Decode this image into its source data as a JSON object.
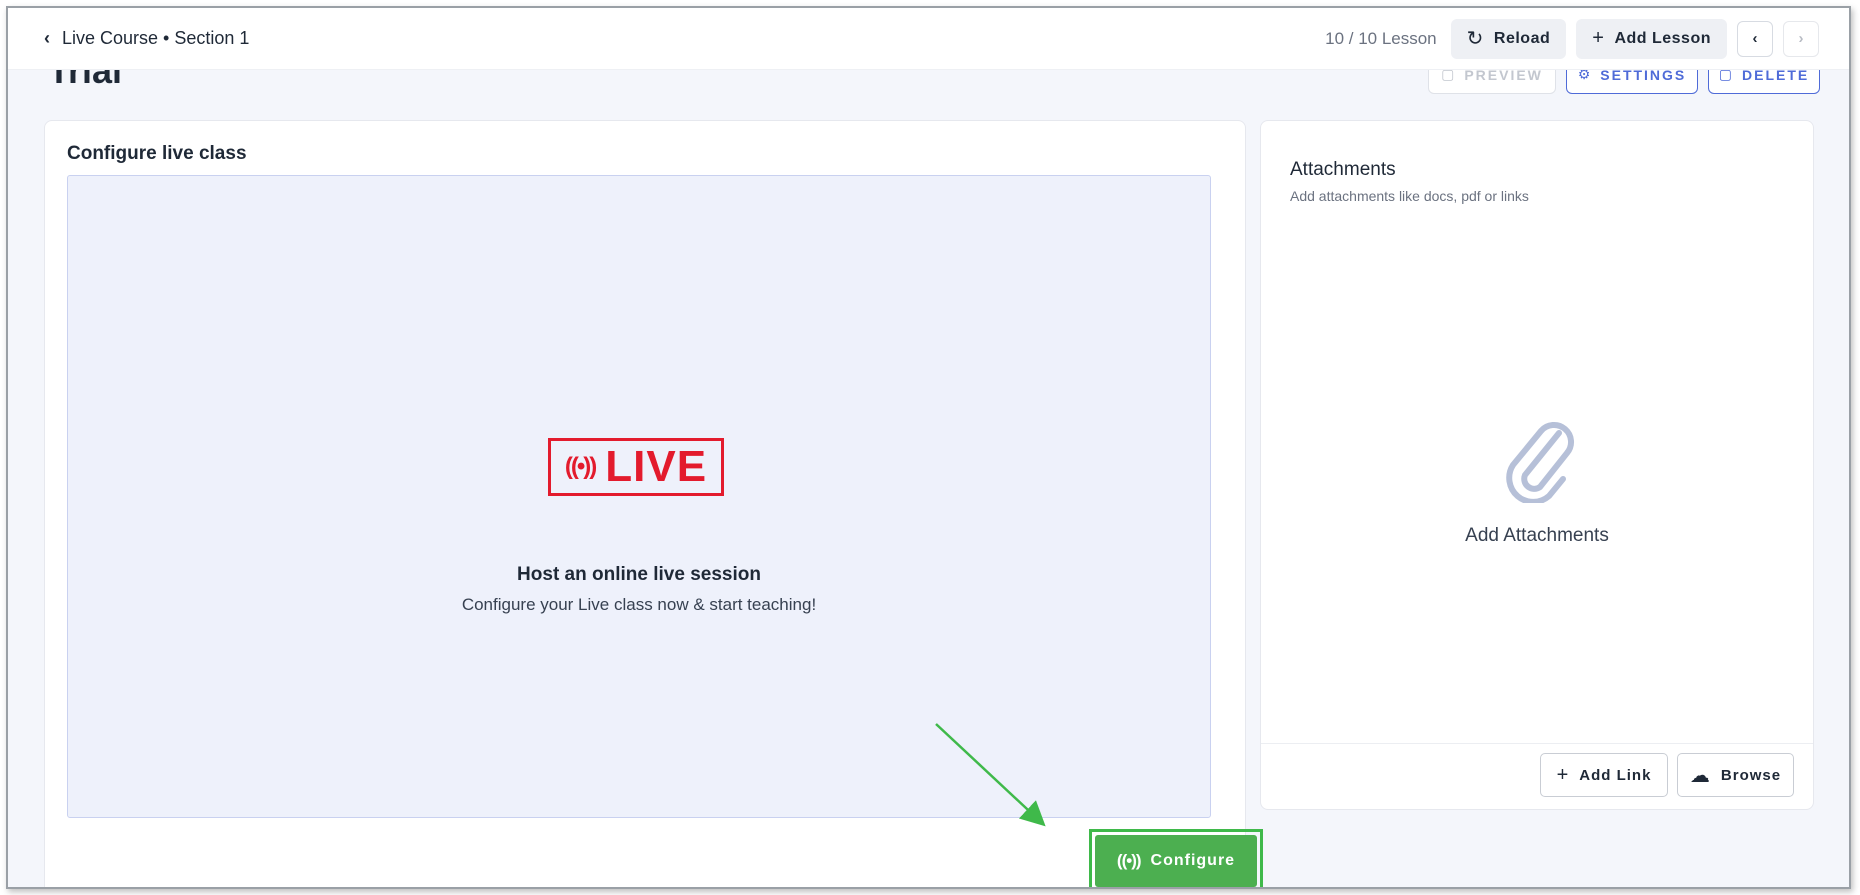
{
  "topbar": {
    "back_icon": "chevron-left-icon",
    "breadcrumb": "Live Course • Section 1",
    "lesson_count": "10 / 10 Lesson",
    "reload_label": "Reload",
    "add_lesson_label": "Add Lesson",
    "prev_icon": "chevron-left-icon",
    "next_icon": "chevron-right-icon"
  },
  "header": {
    "title": "Trial",
    "preview_label": "PREVIEW",
    "settings_label": "SETTINGS",
    "delete_label": "DELETE"
  },
  "live_class": {
    "title": "Configure live class",
    "badge_text": "LIVE",
    "heading": "Host an online live session",
    "subtext": "Configure your Live class now & start teaching!",
    "configure_label": "Configure",
    "accent": "#e31b2d",
    "configure_color": "#4caf50"
  },
  "attachments": {
    "title": "Attachments",
    "subtitle": "Add attachments like docs, pdf or links",
    "empty_label": "Add Attachments",
    "add_link_label": "Add Link",
    "browse_label": "Browse"
  }
}
